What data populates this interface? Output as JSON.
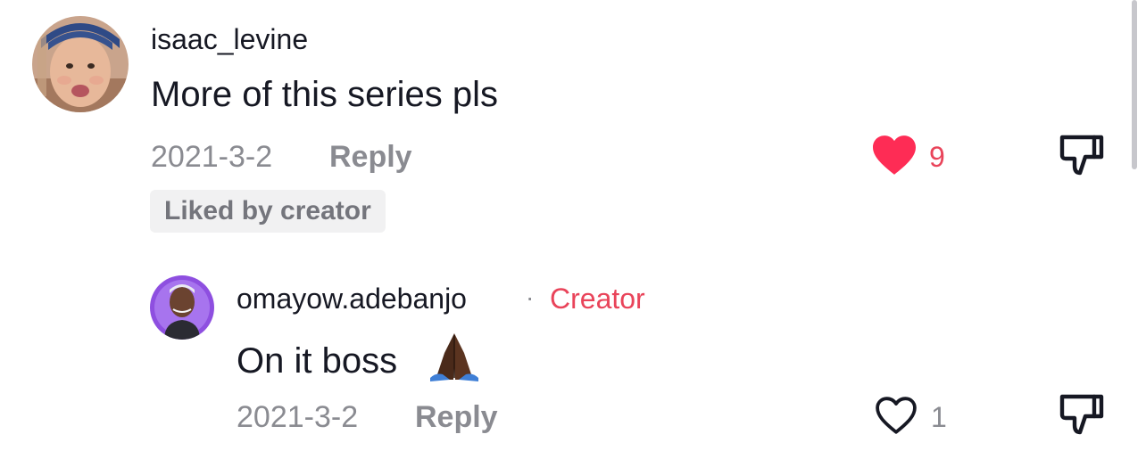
{
  "colors": {
    "text": "#161823",
    "muted": "#8a8b91",
    "like_red": "#fe2c55",
    "creator_red": "#e9445a"
  },
  "comments": [
    {
      "username": "isaac_levine",
      "text": "More of this series pls",
      "date": "2021-3-2",
      "reply_label": "Reply",
      "likes": "9",
      "liked": true,
      "badge": "Liked by creator"
    }
  ],
  "replies": [
    {
      "username": "omayow.adebanjo",
      "separator": "·",
      "role_tag": "Creator",
      "text": "On it boss",
      "emoji": "🙏🏿",
      "date": "2021-3-2",
      "reply_label": "Reply",
      "likes": "1",
      "liked": false
    }
  ],
  "icons": {
    "like_filled": "heart-filled-icon",
    "like_outline": "heart-outline-icon",
    "dislike": "thumbs-down-icon",
    "emoji": "folded-hands-icon"
  }
}
